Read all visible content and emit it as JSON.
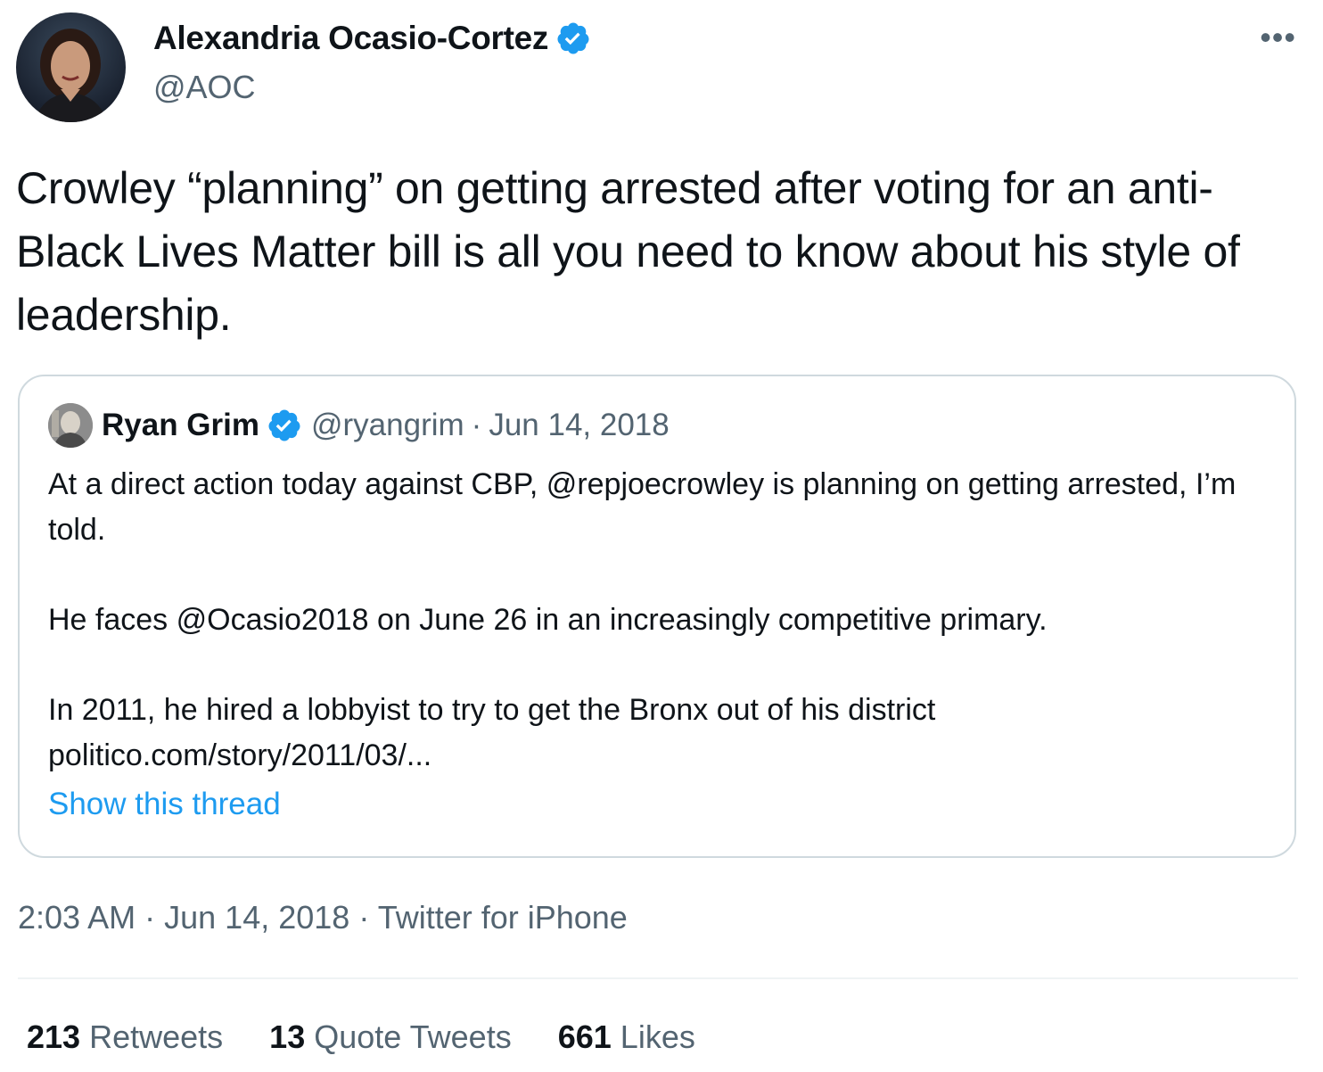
{
  "tweet": {
    "author": {
      "name": "Alexandria Ocasio-Cortez",
      "handle": "@AOC",
      "verified_icon": "verified-badge-icon",
      "avatar": "profile-photo"
    },
    "more_icon": "more-options-icon",
    "text": "Crowley “planning” on getting arrested after voting for an anti-Black Lives Matter bill is all you need to know about his style of leadership.",
    "quoted_tweet": {
      "author_name": "Ryan Grim",
      "author_handle": "@ryangrim",
      "separator": "·",
      "date": "Jun 14, 2018",
      "paragraphs": [
        "At a direct action today against CBP, @repjoecrowley is planning on getting arrested, I’m told.",
        "He faces @Ocasio2018 on June 26 in an increasingly competitive primary.",
        "In 2011, he hired a lobbyist to try to get the Bronx out of his district politico.com/story/2011/03/..."
      ],
      "show_thread_label": "Show this thread"
    },
    "time": "2:03 AM",
    "date": "Jun 14, 2018",
    "source": "Twitter for iPhone",
    "separator": "·",
    "stats": {
      "retweets": {
        "count": "213",
        "label": "Retweets"
      },
      "quote_tweets": {
        "count": "13",
        "label": "Quote Tweets"
      },
      "likes": {
        "count": "661",
        "label": "Likes"
      }
    }
  },
  "colors": {
    "text_primary": "#0f1419",
    "text_secondary": "#536471",
    "link": "#1d9bf0",
    "verified": "#1d9bf0",
    "border": "#cfd9de"
  }
}
